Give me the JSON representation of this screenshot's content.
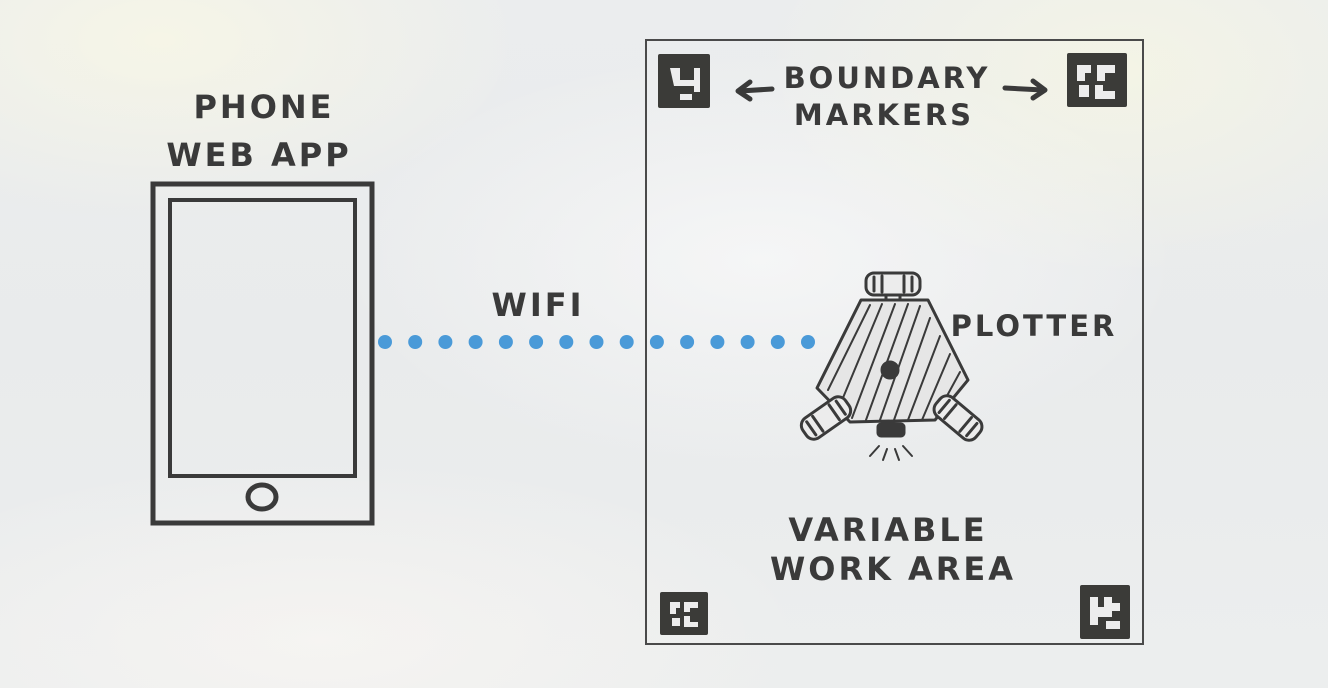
{
  "diagram": {
    "phone": {
      "title_line1": "PHONE",
      "title_line2": "WEB APP"
    },
    "connection": {
      "label": "WIFI",
      "dot_color": "#4a9ad8",
      "dot_count": 15
    },
    "work_area": {
      "markers_label_line1": "BOUNDARY",
      "markers_label_line2": "MARKERS",
      "plotter_label": "PLOTTER",
      "area_label_line1": "VARIABLE",
      "area_label_line2": "WORK AREA"
    },
    "colors": {
      "ink": "#3a3a3a",
      "marker_fill": "#3b3b38",
      "background": "#ebedee"
    }
  }
}
